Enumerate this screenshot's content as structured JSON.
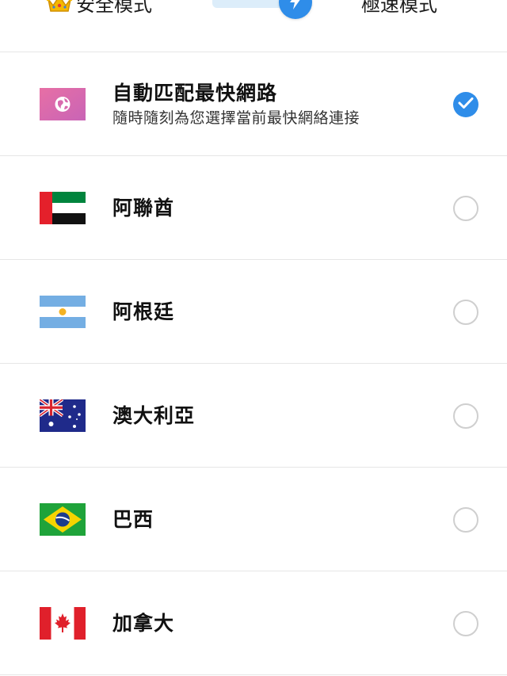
{
  "header": {
    "safe_mode_label": "安全模式",
    "fast_mode_label": "極速模式",
    "safe_mode_icon": "crown-icon",
    "toggle_icon": "lightning-icon",
    "toggle_color": "#2f8de9",
    "toggle_track_color": "#dcedfa"
  },
  "routes": [
    {
      "id": "auto",
      "title": "自動匹配最快網路",
      "subtitle": "隨時隨刻為您選擇當前最快網絡連接",
      "flag_icon": "globe-icon",
      "selected": true
    },
    {
      "id": "uae",
      "title": "阿聯酋",
      "flag_icon": "uae-flag-icon",
      "selected": false
    },
    {
      "id": "argentina",
      "title": "阿根廷",
      "flag_icon": "argentina-flag-icon",
      "selected": false
    },
    {
      "id": "australia",
      "title": "澳大利亞",
      "flag_icon": "australia-flag-icon",
      "selected": false
    },
    {
      "id": "brazil",
      "title": "巴西",
      "flag_icon": "brazil-flag-icon",
      "selected": false
    },
    {
      "id": "canada",
      "title": "加拿大",
      "flag_icon": "canada-flag-icon",
      "selected": false
    }
  ],
  "colors": {
    "accent": "#2f8de9",
    "divider": "#e6e6e6",
    "radio_off": "#cfcfcf"
  }
}
